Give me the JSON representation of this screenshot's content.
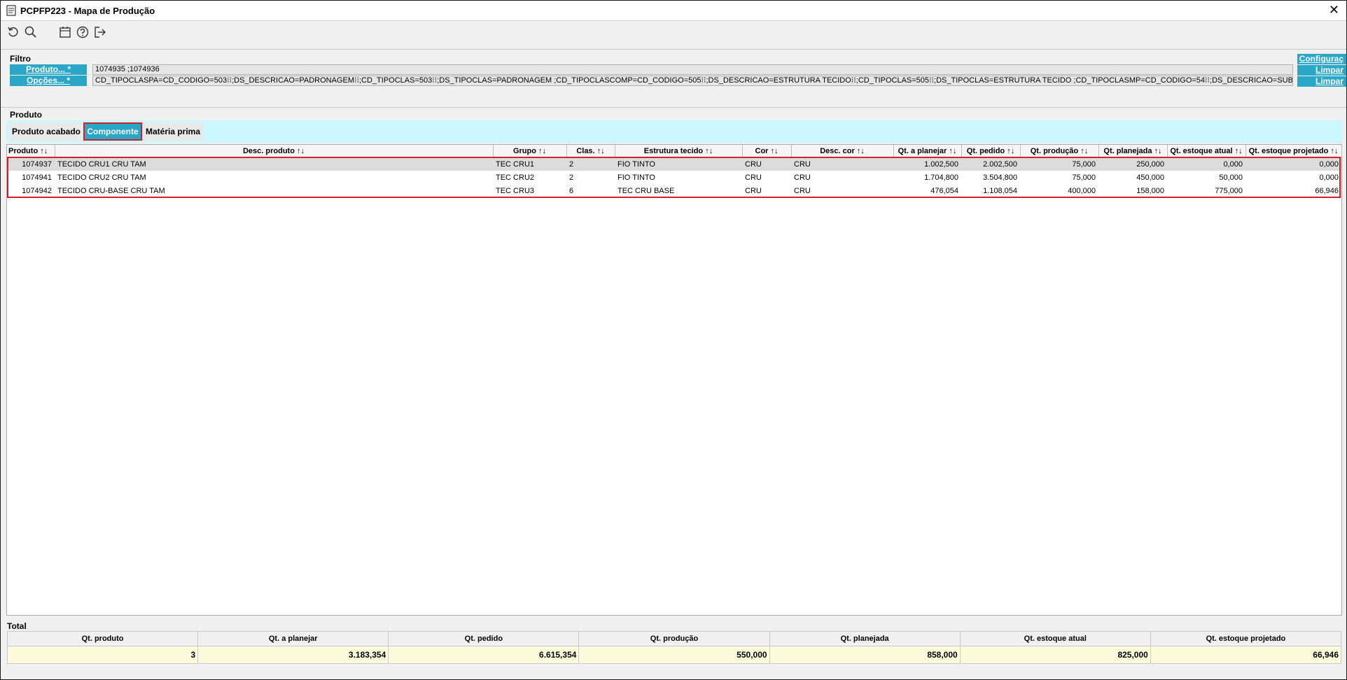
{
  "window": {
    "title": "PCPFP223 - Mapa de Produção",
    "close_label": "✕"
  },
  "toolbar": {
    "icons": [
      "refresh-icon",
      "search-icon",
      "calendar-icon",
      "help-icon",
      "exit-icon"
    ]
  },
  "filter": {
    "section_label": "Filtro",
    "produto_label": "Produto... *",
    "produto_value": "1074935 ;1074936",
    "opcoes_label": "Opções... *",
    "opcoes_value": "CD_TIPOCLASPA=CD_CODIGO=503⁝⁝;DS_DESCRICAO=PADRONAGEM⁝⁝;CD_TIPOCLAS=503⁝⁝;DS_TIPOCLAS=PADRONAGEM ;CD_TIPOCLASCOMP=CD_CODIGO=505⁝⁝;DS_DESCRICAO=ESTRUTURA TECIDO⁝⁝;CD_TIPOCLAS=505⁝⁝;DS_TIPOCLAS=ESTRUTURA TECIDO ;CD_TIPOCLASMP=CD_CODIGO=54⁝⁝;DS_DESCRICAO=SUBGRUPO⁝⁝;CD_",
    "config_label": "Configuraç",
    "limpar1_label": "Limpar",
    "limpar2_label": "Limpar"
  },
  "produto_section": {
    "label": "Produto"
  },
  "tabs": [
    {
      "label": "Produto acabado",
      "active": false
    },
    {
      "label": "Componente",
      "active": true
    },
    {
      "label": "Matéria prima",
      "active": false
    }
  ],
  "grid": {
    "columns": [
      "Produto ↑↓",
      "Desc. produto ↑↓",
      "Grupo ↑↓",
      "Clas. ↑↓",
      "Estrutura tecido ↑↓",
      "Cor ↑↓",
      "Desc. cor ↑↓",
      "Qt. a planejar ↑↓",
      "Qt. pedido ↑↓",
      "Qt. produção ↑↓",
      "Qt. planejada ↑↓",
      "Qt. estoque atual ↑↓",
      "Qt. estoque projetado ↑↓"
    ],
    "rows": [
      {
        "produto": "1074937",
        "desc": "TECIDO CRU1 CRU TAM",
        "grupo": "TEC CRU1",
        "clas": "2",
        "estrutura": "FIO TINTO",
        "cor": "CRU",
        "desc_cor": "CRU",
        "qt_planejar": "1.002,500",
        "qt_pedido": "2.002,500",
        "qt_producao": "75,000",
        "qt_planejada": "250,000",
        "qt_estoque_atual": "0,000",
        "qt_estoque_proj": "0,000"
      },
      {
        "produto": "1074941",
        "desc": "TECIDO CRU2 CRU TAM",
        "grupo": "TEC CRU2",
        "clas": "2",
        "estrutura": "FIO TINTO",
        "cor": "CRU",
        "desc_cor": "CRU",
        "qt_planejar": "1.704,800",
        "qt_pedido": "3.504,800",
        "qt_producao": "75,000",
        "qt_planejada": "450,000",
        "qt_estoque_atual": "50,000",
        "qt_estoque_proj": "0,000"
      },
      {
        "produto": "1074942",
        "desc": "TECIDO CRU-BASE CRU TAM",
        "grupo": "TEC CRU3",
        "clas": "6",
        "estrutura": "TEC CRU BASE",
        "cor": "CRU",
        "desc_cor": "CRU",
        "qt_planejar": "476,054",
        "qt_pedido": "1.108,054",
        "qt_producao": "400,000",
        "qt_planejada": "158,000",
        "qt_estoque_atual": "775,000",
        "qt_estoque_proj": "66,946"
      }
    ]
  },
  "totals": {
    "label": "Total",
    "headers": [
      "Qt. produto",
      "Qt. a planejar",
      "Qt. pedido",
      "Qt. produção",
      "Qt. planejada",
      "Qt. estoque atual",
      "Qt. estoque projetado"
    ],
    "values": [
      "3",
      "3.183,354",
      "6.615,354",
      "550,000",
      "858,000",
      "825,000",
      "66,946"
    ]
  },
  "colors": {
    "accent": "#2aa6c6",
    "highlight": "#d0202a",
    "tabs_bg": "#cbf7ff",
    "totals_bg": "#fbfbdc"
  }
}
